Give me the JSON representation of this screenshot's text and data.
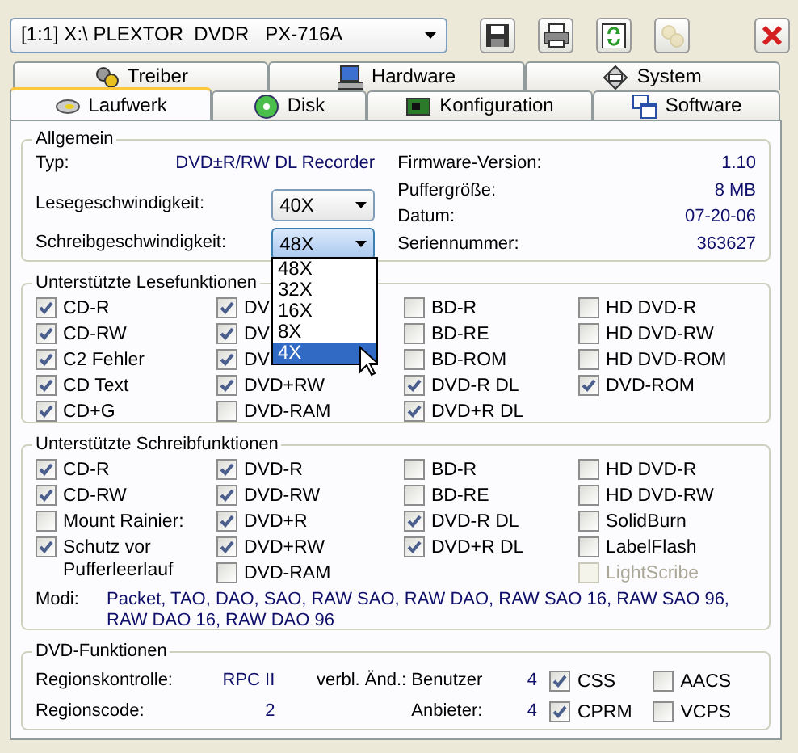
{
  "drive_select": {
    "value": "[1:1] X:\\ PLEXTOR  DVDR   PX-716A"
  },
  "toolbar": [
    {
      "kind": "save",
      "disabled": false
    },
    {
      "kind": "print",
      "disabled": false
    },
    {
      "kind": "refresh",
      "disabled": false
    },
    {
      "kind": "tools",
      "disabled": true
    },
    {
      "kind": "close",
      "disabled": false
    }
  ],
  "tabs_top": [
    {
      "label": "Treiber",
      "kind": "gears"
    },
    {
      "label": "Hardware",
      "kind": "computer"
    },
    {
      "label": "System",
      "kind": "diamond"
    }
  ],
  "tabs_bottom": [
    {
      "label": "Laufwerk",
      "kind": "drive",
      "selected": true
    },
    {
      "label": "Disk",
      "kind": "disc",
      "selected": false
    },
    {
      "label": "Konfiguration",
      "kind": "card",
      "selected": false
    },
    {
      "label": "Software",
      "kind": "windows",
      "selected": false
    }
  ],
  "general": {
    "title": "Allgemein",
    "type_label": "Typ:",
    "type_value": "DVD±R/RW DL Recorder",
    "read_speed": {
      "label": "Lesegeschwindigkeit:",
      "value": "40X",
      "focused": false
    },
    "write_speed": {
      "label": "Schreibgeschwindigkeit:",
      "value": "48X",
      "focused": true
    },
    "info": [
      {
        "label": "Firmware-Version:",
        "value": "1.10"
      },
      {
        "label": "Puffergröße:",
        "value": "8 MB"
      },
      {
        "label": "Datum:",
        "value": "07-20-06"
      },
      {
        "label": "Seriennummer:",
        "value": "363627"
      }
    ]
  },
  "speed_menu": {
    "options": [
      {
        "label": "48X",
        "selected": false
      },
      {
        "label": "32X",
        "selected": false
      },
      {
        "label": "16X",
        "selected": false
      },
      {
        "label": "8X",
        "selected": false
      },
      {
        "label": "4X",
        "selected": true
      }
    ]
  },
  "read_functions": {
    "title": "Unterstützte Lesefunktionen",
    "columns": [
      [
        {
          "label": "CD-R",
          "checked": true
        },
        {
          "label": "CD-RW",
          "checked": true
        },
        {
          "label": "C2 Fehler",
          "checked": true
        },
        {
          "label": "CD Text",
          "checked": true
        },
        {
          "label": "CD+G",
          "checked": true
        }
      ],
      [
        {
          "label": "DV",
          "checked": true
        },
        {
          "label": "DV",
          "checked": true
        },
        {
          "label": "DV",
          "checked": true
        },
        {
          "label": "DVD+RW",
          "checked": true
        },
        {
          "label": "DVD-RAM",
          "checked": false
        }
      ],
      [
        {
          "label": "BD-R",
          "checked": false
        },
        {
          "label": "BD-RE",
          "checked": false
        },
        {
          "label": "BD-ROM",
          "checked": false
        },
        {
          "label": "DVD-R DL",
          "checked": true
        },
        {
          "label": "DVD+R DL",
          "checked": true
        }
      ],
      [
        {
          "label": "HD DVD-R",
          "checked": false
        },
        {
          "label": "HD DVD-RW",
          "checked": false
        },
        {
          "label": "HD DVD-ROM",
          "checked": false
        },
        {
          "label": "DVD-ROM",
          "checked": true
        }
      ]
    ]
  },
  "write_functions": {
    "title": "Unterstützte Schreibfunktionen",
    "columns": [
      [
        {
          "label": "CD-R",
          "checked": true,
          "disabled": false
        },
        {
          "label": "CD-RW",
          "checked": true,
          "disabled": false
        },
        {
          "label": "Mount Rainier:",
          "checked": false,
          "disabled": false
        },
        {
          "label": "Schutz vor Pufferleerlauf",
          "checked": true,
          "disabled": false
        }
      ],
      [
        {
          "label": "DVD-R",
          "checked": true,
          "disabled": false
        },
        {
          "label": "DVD-RW",
          "checked": true,
          "disabled": false
        },
        {
          "label": "DVD+R",
          "checked": true,
          "disabled": false
        },
        {
          "label": "DVD+RW",
          "checked": true,
          "disabled": false
        },
        {
          "label": "DVD-RAM",
          "checked": false,
          "disabled": false
        }
      ],
      [
        {
          "label": "BD-R",
          "checked": false,
          "disabled": false
        },
        {
          "label": "BD-RE",
          "checked": false,
          "disabled": false
        },
        {
          "label": "DVD-R DL",
          "checked": true,
          "disabled": false
        },
        {
          "label": "DVD+R DL",
          "checked": true,
          "disabled": false
        }
      ],
      [
        {
          "label": "HD DVD-R",
          "checked": false,
          "disabled": false
        },
        {
          "label": "HD DVD-RW",
          "checked": false,
          "disabled": false
        },
        {
          "label": "SolidBurn",
          "checked": false,
          "disabled": false
        },
        {
          "label": "LabelFlash",
          "checked": false,
          "disabled": false
        },
        {
          "label": "LightScribe",
          "checked": false,
          "disabled": true
        }
      ]
    ],
    "modes_label": "Modi:",
    "modes_value": "Packet, TAO, DAO, SAO, RAW SAO, RAW DAO, RAW SAO 16, RAW SAO 96, RAW DAO 16, RAW DAO 96"
  },
  "dvd_functions": {
    "title": "DVD-Funktionen",
    "region_control_label": "Regionskontrolle:",
    "region_control_value": "RPC II",
    "region_code_label": "Regionscode:",
    "region_code_value": "2",
    "changes_label": "verbl. Änd.: Benutzer",
    "user_value": "4",
    "vendor_label": "Anbieter:",
    "vendor_value": "4",
    "checks": [
      {
        "label": "CSS",
        "checked": true
      },
      {
        "label": "AACS",
        "checked": false
      },
      {
        "label": "CPRM",
        "checked": true
      },
      {
        "label": "VCPS",
        "checked": false
      }
    ]
  }
}
